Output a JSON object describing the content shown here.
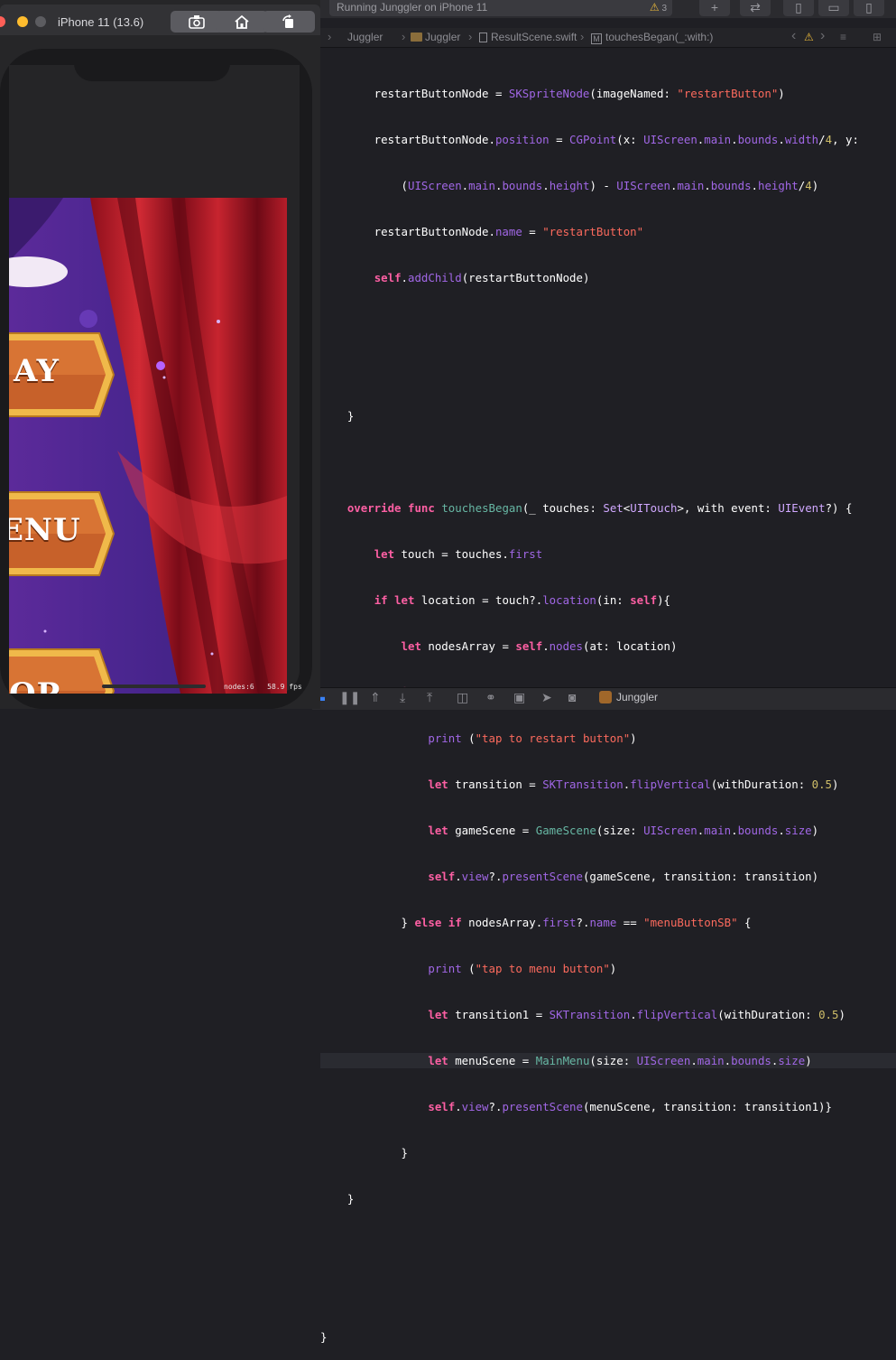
{
  "simulator": {
    "title": "iPhone 11 (13.6)",
    "buttons": [
      {
        "name": "screenshot-button",
        "icon": "camera-icon"
      },
      {
        "name": "home-button",
        "icon": "home-icon"
      },
      {
        "name": "rotate-button",
        "icon": "rotate-icon"
      }
    ],
    "game": {
      "buttons": [
        "AY",
        "ENU",
        "OP"
      ],
      "hud": "nodes:6   58.9 fps"
    }
  },
  "xcode": {
    "activity_text": "Running Junggler on iPhone 11",
    "warning_count": "3",
    "breadcrumb": [
      "Juggler",
      "Juggler",
      "ResultScene.swift",
      "touchesBegan(_:with:)"
    ],
    "breadcrumb_method_badge": "M",
    "code_lines": [
      "        restartButtonNode = SKSpriteNode(imageNamed: \"restartButton\")",
      "        restartButtonNode.position = CGPoint(x: UIScreen.main.bounds.width/4, y:",
      "            (UIScreen.main.bounds.height) - UIScreen.main.bounds.height/4)",
      "        restartButtonNode.name = \"restartButton\"",
      "        self.addChild(restartButtonNode)",
      "",
      "",
      "    }",
      "",
      "    override func touchesBegan(_ touches: Set<UITouch>, with event: UIEvent?) {",
      "        let touch = touches.first",
      "        if let location = touch?.location(in: self){",
      "            let nodesArray = self.nodes(at: location)",
      "            if nodesArray.first?.name == \"restartButton\"{",
      "                print (\"tap to restart button\")",
      "                let transition = SKTransition.flipVertical(withDuration: 0.5)",
      "                let gameScene = GameScene(size: UIScreen.main.bounds.size)",
      "                self.view?.presentScene(gameScene, transition: transition)",
      "            } else if nodesArray.first?.name == \"menuButtonSB\" {",
      "                print (\"tap to menu button\")",
      "                let transition1 = SKTransition.flipVertical(withDuration: 0.5)",
      "                let menuScene = MainMenu(size: UIScreen.main.bounds.size)",
      "                self.view?.presentScene(menuScene, transition: transition1)}",
      "            }",
      "    }",
      "",
      "",
      "}"
    ],
    "highlighted_line": 21,
    "debug_target": "Junggler"
  },
  "colors": {
    "keyword": "#fc5fa3",
    "string": "#fc6a5d",
    "number": "#d0bf69",
    "type": "#d0a8ff",
    "property": "#a167e6",
    "function": "#67b7a4",
    "warning": "#e8b73a"
  }
}
